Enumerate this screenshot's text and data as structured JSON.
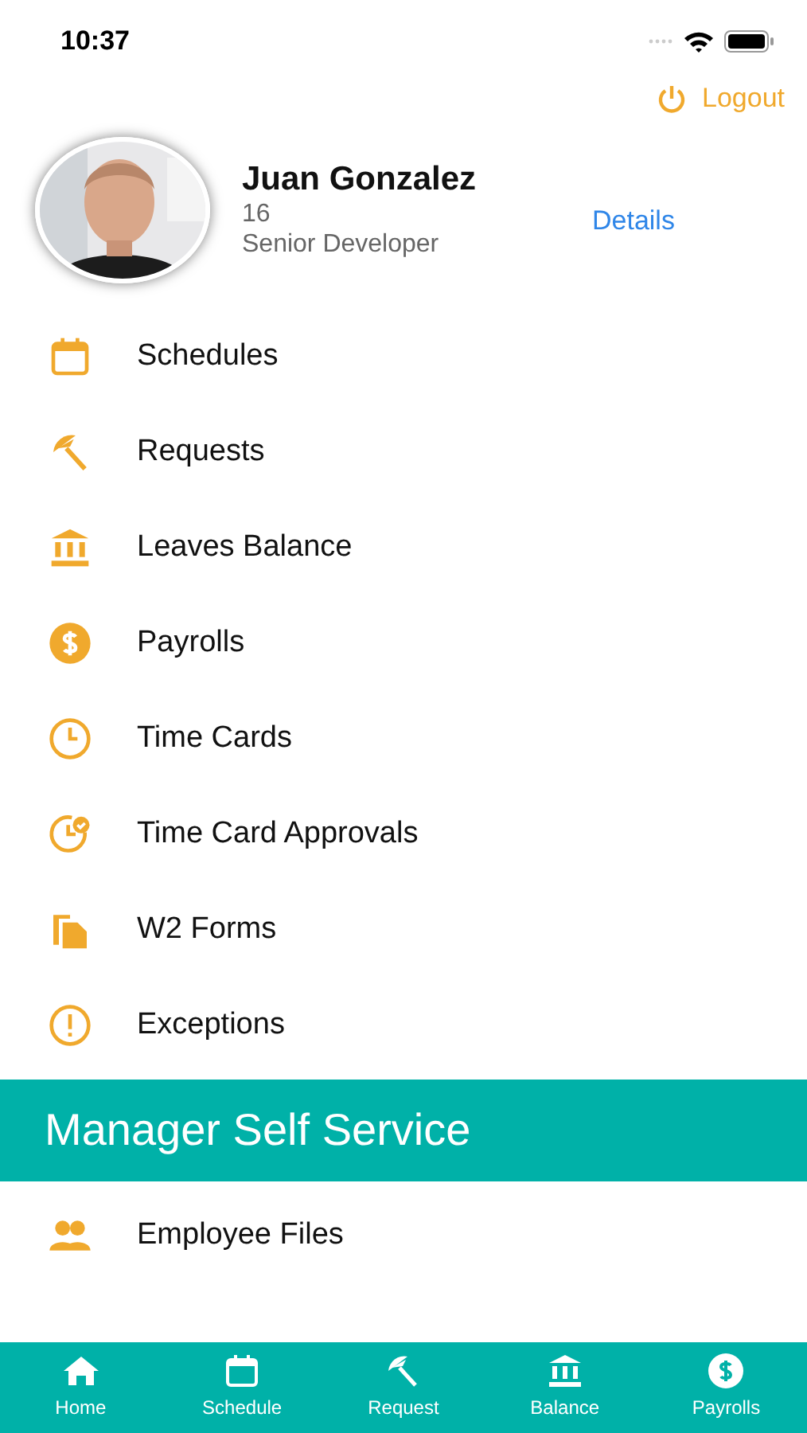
{
  "status_bar": {
    "time": "10:37"
  },
  "logout": {
    "label": "Logout"
  },
  "profile": {
    "name": "Juan Gonzalez",
    "id": "16",
    "title": "Senior Developer",
    "details_link": "Details"
  },
  "menu_items": [
    {
      "label": "Schedules",
      "kind": "calendar"
    },
    {
      "label": "Requests",
      "kind": "umbrella"
    },
    {
      "label": "Leaves Balance",
      "kind": "bank"
    },
    {
      "label": "Payrolls",
      "kind": "dollar"
    },
    {
      "label": "Time Cards",
      "kind": "clock"
    },
    {
      "label": "Time Card Approvals",
      "kind": "approval"
    },
    {
      "label": "W2 Forms",
      "kind": "files"
    },
    {
      "label": "Exceptions",
      "kind": "alert"
    }
  ],
  "section_header": "Manager Self Service",
  "manager_items": [
    {
      "label": "Employee Files",
      "kind": "people"
    }
  ],
  "tab_bar": [
    {
      "label": "Home",
      "kind": "home"
    },
    {
      "label": "Schedule",
      "kind": "calendar"
    },
    {
      "label": "Request",
      "kind": "umbrella"
    },
    {
      "label": "Balance",
      "kind": "bank"
    },
    {
      "label": "Payrolls",
      "kind": "dollar"
    }
  ]
}
